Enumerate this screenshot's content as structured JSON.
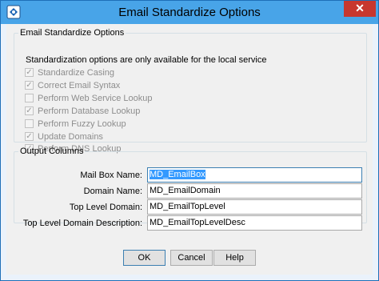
{
  "window": {
    "title": "Email Standardize Options",
    "close_glyph": "✕",
    "app_icon": "app-icon"
  },
  "options_group": {
    "legend": "Email Standardize Options",
    "note": "Standardization options are only available for the local service",
    "options": [
      {
        "label": "Standardize Casing",
        "checked": true
      },
      {
        "label": "Correct Email Syntax",
        "checked": true
      },
      {
        "label": "Perform Web Service Lookup",
        "checked": false
      },
      {
        "label": "Perform Database Lookup",
        "checked": true
      },
      {
        "label": "Perform Fuzzy Lookup",
        "checked": false
      },
      {
        "label": "Update Domains",
        "checked": true
      },
      {
        "label": "Perform DNS Lookup",
        "checked": true
      }
    ]
  },
  "output_group": {
    "legend": "Output Columns",
    "fields": [
      {
        "label": "Mail Box Name:",
        "value": "MD_EmailBox"
      },
      {
        "label": "Domain Name:",
        "value": "MD_EmailDomain"
      },
      {
        "label": "Top Level Domain:",
        "value": "MD_EmailTopLevel"
      },
      {
        "label": "Top Level Domain Description:",
        "value": "MD_EmailTopLevelDesc"
      }
    ]
  },
  "buttons": {
    "ok": "OK",
    "cancel": "Cancel",
    "help": "Help"
  }
}
